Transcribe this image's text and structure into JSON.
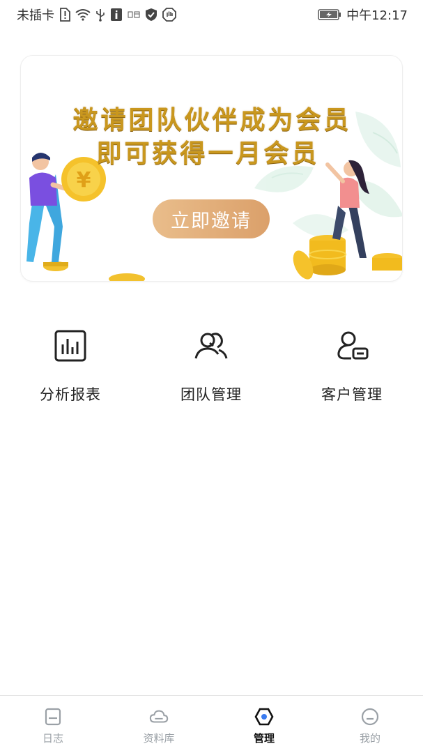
{
  "status_bar": {
    "carrier": "未插卡",
    "time": "中午12:17",
    "icons": [
      "sim-alert-icon",
      "wifi-icon",
      "usb-icon",
      "info-icon",
      "calendar-icon",
      "shield-icon",
      "hand-icon",
      "battery-charging-icon"
    ]
  },
  "banner": {
    "line1": "邀请团队伙伴成为会员",
    "line2": "即可获得一月会员",
    "button_label": "立即邀请",
    "yuan_symbol": "¥",
    "colors": {
      "title_gold": "#c9971e",
      "button": "#e2ad78",
      "coin": "#f5c22b",
      "leaf": "#dff3ea"
    }
  },
  "features": [
    {
      "label": "分析报表",
      "icon": "bar-chart-icon"
    },
    {
      "label": "团队管理",
      "icon": "team-icon"
    },
    {
      "label": "客户管理",
      "icon": "customer-icon"
    }
  ],
  "tabs": [
    {
      "label": "日志",
      "icon": "journal-icon",
      "active": false
    },
    {
      "label": "资料库",
      "icon": "cloud-icon",
      "active": false
    },
    {
      "label": "管理",
      "icon": "management-icon",
      "active": true
    },
    {
      "label": "我的",
      "icon": "profile-icon",
      "active": false
    }
  ],
  "colors": {
    "active_tab": "#111111",
    "inactive_tab": "#9aa0a6",
    "accent_blue": "#3a7bf0"
  }
}
